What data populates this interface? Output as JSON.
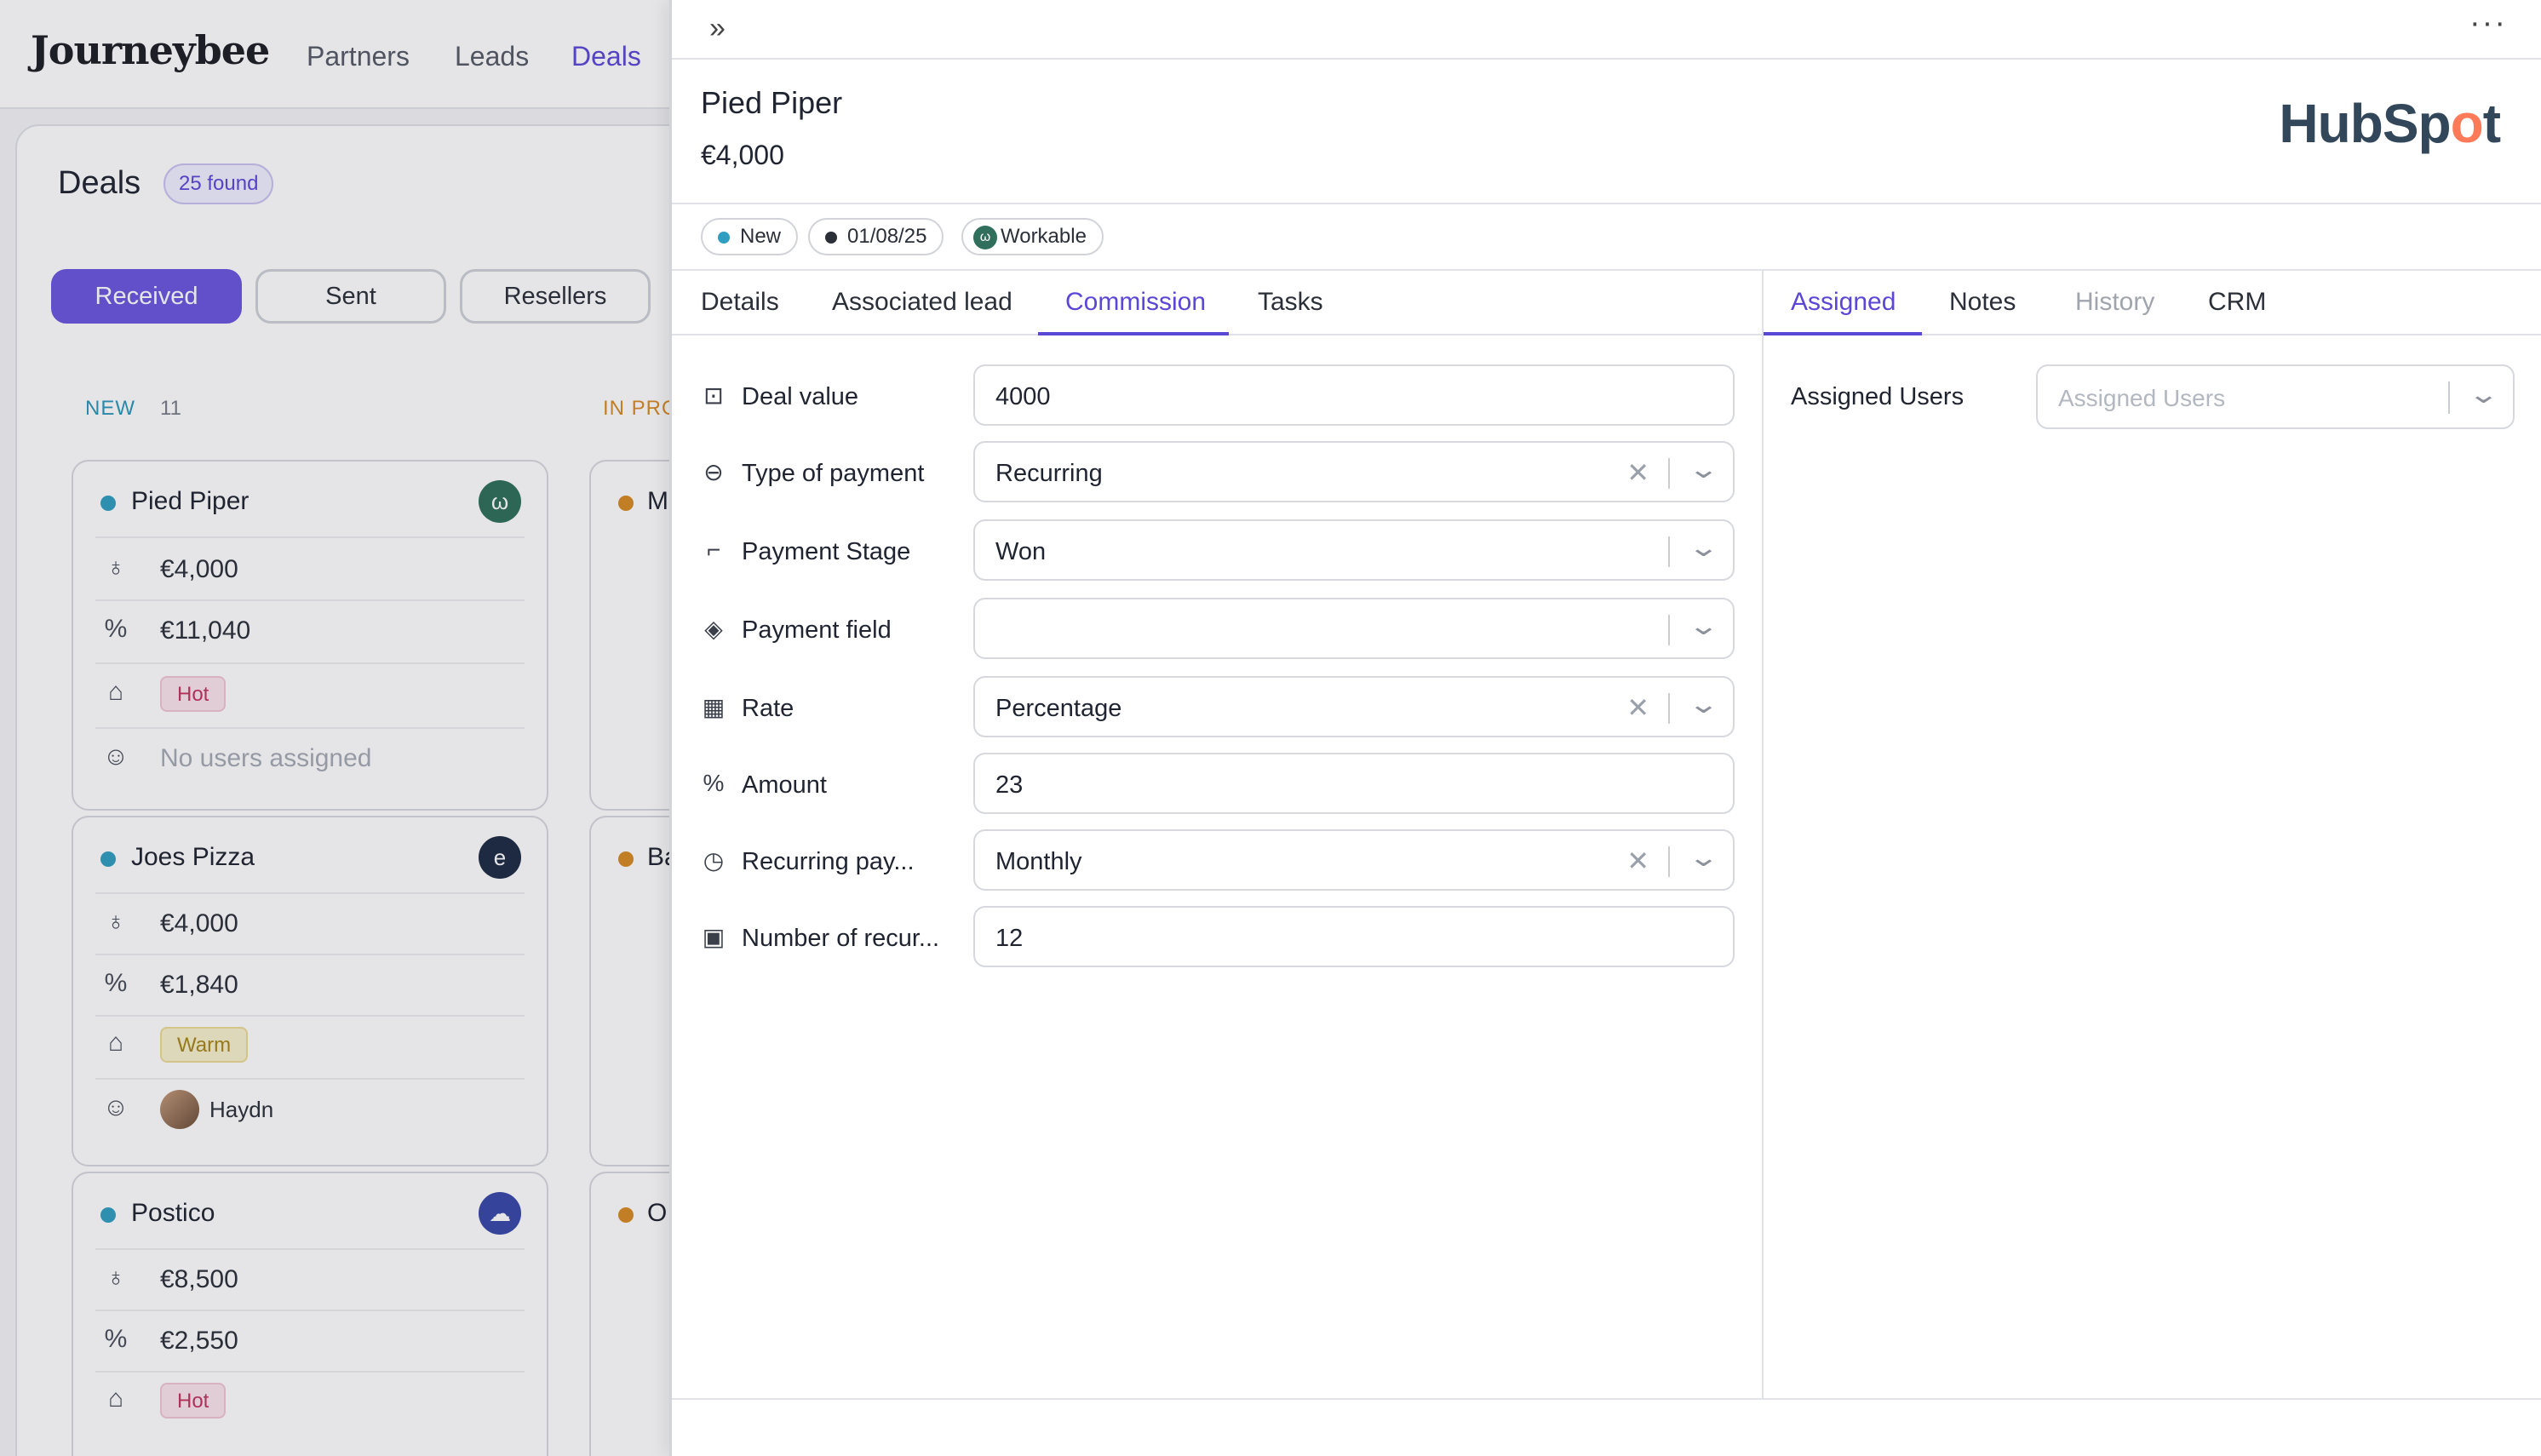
{
  "app": {
    "logo": "Journeybee",
    "nav": [
      "Partners",
      "Leads",
      "Deals"
    ],
    "active_nav": "Deals"
  },
  "board": {
    "title": "Deals",
    "found": "25 found",
    "pills": [
      "Received",
      "Sent",
      "Resellers"
    ],
    "column_new": "NEW",
    "column_new_count": "11",
    "column_progress": "IN PRO",
    "cards": [
      {
        "name": "Pied Piper",
        "value": "€4,000",
        "commission": "€11,040",
        "tag": "Hot",
        "users": "No users assigned"
      },
      {
        "name": "Joes Pizza",
        "value": "€4,000",
        "commission": "€1,840",
        "tag": "Warm",
        "users": "Haydn"
      },
      {
        "name": "Postico",
        "value": "€8,500",
        "commission": "€2,550",
        "tag": "Hot"
      }
    ],
    "cards_right": [
      {
        "name": "M"
      },
      {
        "name": "Ba"
      },
      {
        "name": "O"
      }
    ]
  },
  "panel": {
    "deal_name": "Pied Piper",
    "deal_amount": "€4,000",
    "crm_logo": "HubSpot",
    "chips": {
      "status": "New",
      "date": "01/08/25",
      "company": "Workable"
    },
    "tabs_left": [
      "Details",
      "Associated lead",
      "Commission",
      "Tasks"
    ],
    "tabs_right": [
      "Assigned",
      "Notes",
      "History",
      "CRM"
    ],
    "fields": {
      "deal_value": {
        "label": "Deal value",
        "value": "4000"
      },
      "type_of_payment": {
        "label": "Type of payment",
        "value": "Recurring"
      },
      "payment_stage": {
        "label": "Payment Stage",
        "value": "Won"
      },
      "payment_field": {
        "label": "Payment field",
        "value": ""
      },
      "rate": {
        "label": "Rate",
        "value": "Percentage"
      },
      "amount": {
        "label": "Amount",
        "value": "23"
      },
      "recurring_pay": {
        "label": "Recurring pay...",
        "value": "Monthly"
      },
      "number_of_recur": {
        "label": "Number of recur...",
        "value": "12"
      }
    },
    "assigned": {
      "label": "Assigned Users",
      "placeholder": "Assigned Users"
    }
  },
  "colors": {
    "accent": "#5b47d6",
    "hubspot_orange": "#ff7a59",
    "new_dot": "#2f9ec0",
    "progress_dot": "#d88a22"
  }
}
